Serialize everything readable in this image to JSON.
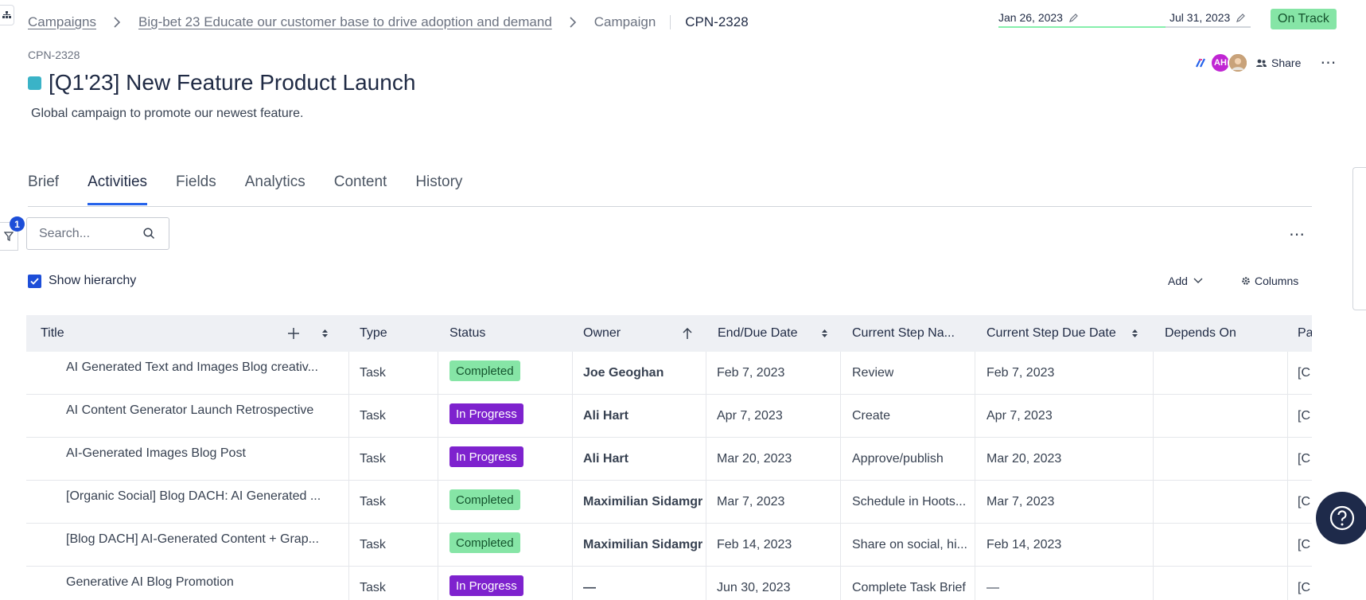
{
  "breadcrumb": {
    "root": "Campaigns",
    "parent": "Big-bet 23 Educate our customer base to drive adoption and demand",
    "type": "Campaign",
    "current": "CPN-2328"
  },
  "dates": {
    "start": "Jan 26, 2023",
    "end": "Jul 31, 2023"
  },
  "status": {
    "label": "On Track",
    "color": "#86e5a6"
  },
  "header": {
    "avatars": [
      "",
      "AH",
      ""
    ],
    "share_label": "Share",
    "more_label": "⋯"
  },
  "campaign": {
    "id": "CPN-2328",
    "title": "[Q1'23] New Feature Product Launch",
    "swatch_color": "#3ab3c7",
    "description": "Global campaign to promote our newest feature."
  },
  "tabs": [
    {
      "label": "Brief"
    },
    {
      "label": "Activities",
      "active": true
    },
    {
      "label": "Fields"
    },
    {
      "label": "Analytics"
    },
    {
      "label": "Content"
    },
    {
      "label": "History"
    }
  ],
  "filter": {
    "count": "1"
  },
  "search": {
    "placeholder": "Search..."
  },
  "toolbar": {
    "show_hierarchy_label": "Show hierarchy",
    "show_hierarchy_checked": true,
    "add_label": "Add",
    "columns_label": "Columns",
    "more_label": "⋯"
  },
  "table": {
    "columns": [
      "Title",
      "Type",
      "Status",
      "Owner",
      "End/Due Date",
      "Current Step Na...",
      "Current Step Due Date",
      "Depends On",
      "Pa"
    ],
    "rows": [
      {
        "title": "AI Generated Text and Images Blog creativ...",
        "type": "Task",
        "status": "Completed",
        "owner": "Joe Geoghan",
        "due": "Feb 7, 2023",
        "step": "Review",
        "step_due": "Feb 7, 2023",
        "depends": "",
        "parent": "[C"
      },
      {
        "title": "AI Content Generator Launch Retrospective",
        "type": "Task",
        "status": "In Progress",
        "owner": "Ali Hart",
        "due": "Apr 7, 2023",
        "step": "Create",
        "step_due": "Apr 7, 2023",
        "depends": "",
        "parent": "[C"
      },
      {
        "title": "AI-Generated Images Blog Post",
        "type": "Task",
        "status": "In Progress",
        "owner": "Ali Hart",
        "due": "Mar 20, 2023",
        "step": "Approve/publish",
        "step_due": "Mar 20, 2023",
        "depends": "",
        "parent": "[C"
      },
      {
        "title": "[Organic Social] Blog DACH: AI Generated ...",
        "type": "Task",
        "status": "Completed",
        "owner": "Maximilian Sidamgro",
        "due": "Mar 7, 2023",
        "step": "Schedule in Hoots...",
        "step_due": "Mar 7, 2023",
        "depends": "",
        "parent": "[C"
      },
      {
        "title": "[Blog DACH] AI-Generated Content + Grap...",
        "type": "Task",
        "status": "Completed",
        "owner": "Maximilian Sidamgro",
        "due": "Feb 14, 2023",
        "step": "Share on social, hi...",
        "step_due": "Feb 14, 2023",
        "depends": "",
        "parent": "[C"
      },
      {
        "title": "Generative AI Blog Promotion",
        "type": "Task",
        "status": "In Progress",
        "owner": "—",
        "due": "Jun 30, 2023",
        "step": "Complete Task Brief",
        "step_due": "—",
        "depends": "",
        "parent": "[C"
      }
    ]
  },
  "colors": {
    "accent": "#2563eb",
    "completed": "#86e5a6",
    "in_progress": "#7e22ce",
    "help": "#1e2a4a"
  },
  "icons": [
    "hierarchy-icon",
    "chevron-right-icon",
    "pencil-icon",
    "share-people-icon",
    "filter-icon",
    "search-icon",
    "check-icon",
    "chevron-down-icon",
    "gear-icon",
    "plus-icon",
    "sort-icon",
    "sort-up-icon",
    "help-icon"
  ]
}
